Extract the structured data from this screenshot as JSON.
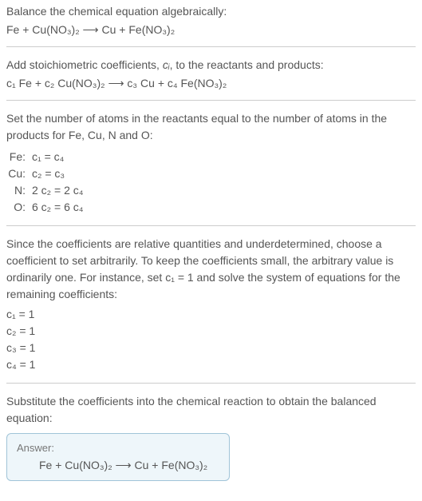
{
  "section1": {
    "text": "Balance the chemical equation algebraically:",
    "eq": "Fe + Cu(NO₃)₂  ⟶  Cu + Fe(NO₃)₂"
  },
  "section2": {
    "text_pre": "Add stoichiometric coefficients, ",
    "ci": "cᵢ",
    "text_post": ", to the reactants and products:",
    "eq": "c₁ Fe + c₂ Cu(NO₃)₂  ⟶  c₃ Cu + c₄ Fe(NO₃)₂"
  },
  "section3": {
    "text": "Set the number of atoms in the reactants equal to the number of atoms in the products for Fe, Cu, N and O:",
    "rows": [
      {
        "label": "Fe:",
        "eq": "c₁ = c₄"
      },
      {
        "label": "Cu:",
        "eq": "c₂ = c₃"
      },
      {
        "label": "N:",
        "eq": "2 c₂ = 2 c₄"
      },
      {
        "label": "O:",
        "eq": "6 c₂ = 6 c₄"
      }
    ]
  },
  "section4": {
    "text": "Since the coefficients are relative quantities and underdetermined, choose a coefficient to set arbitrarily. To keep the coefficients small, the arbitrary value is ordinarily one. For instance, set c₁ = 1 and solve the system of equations for the remaining coefficients:",
    "coefs": [
      "c₁ = 1",
      "c₂ = 1",
      "c₃ = 1",
      "c₄ = 1"
    ]
  },
  "section5": {
    "text": "Substitute the coefficients into the chemical reaction to obtain the balanced equation:"
  },
  "answer": {
    "label": "Answer:",
    "eq": "Fe + Cu(NO₃)₂  ⟶  Cu + Fe(NO₃)₂"
  }
}
